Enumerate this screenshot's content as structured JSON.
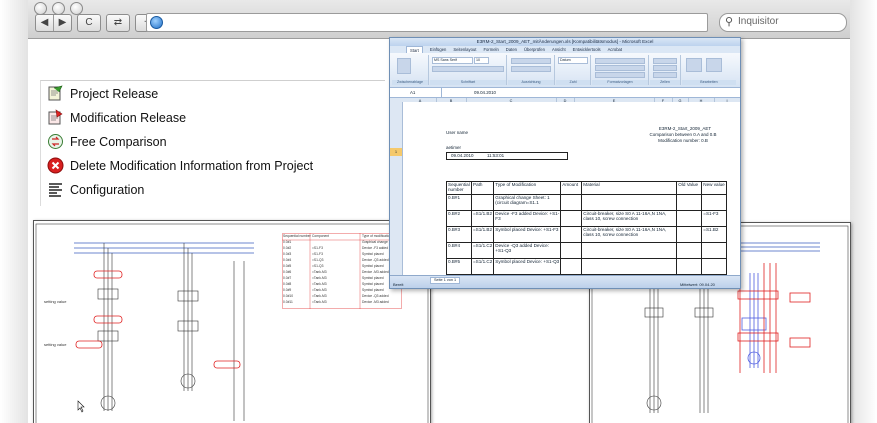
{
  "browser": {
    "search_placeholder": "Inquisitor",
    "nav_labels": [
      "◀",
      "▶",
      "C",
      "⇄",
      "+"
    ]
  },
  "menu": {
    "items": [
      {
        "label": "Project Release",
        "icon": "project-release-icon"
      },
      {
        "label": "Modification Release",
        "icon": "modification-release-icon"
      },
      {
        "label": "Free Comparison",
        "icon": "free-comparison-icon"
      },
      {
        "label": "Delete Modification Information from Project",
        "icon": "delete-modification-icon"
      },
      {
        "label": "Configuration",
        "icon": "configuration-icon"
      }
    ]
  },
  "excel": {
    "title": "E3RM-2_Start_2009_AET_mitÄnderungen.xls [Kompatibilitätsmodus] - Microsoft Excel",
    "tabs": [
      "Start",
      "Einfügen",
      "Seitenlayout",
      "Formeln",
      "Daten",
      "Überprüfen",
      "Ansicht",
      "Entwicklertools",
      "Acrobat"
    ],
    "groups": [
      "Zwischenablage",
      "Schriftart",
      "Ausrichtung",
      "Zahl",
      "Formatvorlagen",
      "Zellen",
      "Bearbeiten"
    ],
    "font_name": "MS Sans Serif",
    "font_size": "10",
    "number_format": "Datum",
    "cell_ref": "A1",
    "formula_value": "09.04.2010",
    "col_headers": [
      "A",
      "B",
      "C",
      "D",
      "E",
      "F",
      "G",
      "H",
      "I"
    ],
    "doc": {
      "right_title": "E3RM-2_Start_2009_AET",
      "right_line2": "Comparison between 0.A and 0.B",
      "right_line3": "Modification number: 0.B",
      "user_label": "User name",
      "user_value": "aetimer",
      "date": "09.04.2010",
      "time": "11:53:01",
      "row_num": "1",
      "headers": [
        "Sequential number",
        "Path",
        "Type of Modification",
        "Amount",
        "Material",
        "Old Value",
        "New value"
      ],
      "rows": [
        {
          "seq": "0.B#1",
          "path": "",
          "type": "Graphical change Sheet: 1 (circuit diagram=S1.1",
          "material": "",
          "new": ""
        },
        {
          "seq": "0.B#2",
          "path": "=S1/1.B2",
          "type": "Device -F3 added Device: +S1-F3",
          "material": "Circuit-breaker, size S0 A 11-16A,N 1NA, class 10, screw connection",
          "new": "=S1-F3"
        },
        {
          "seq": "0.B#3",
          "path": "=S1/1.B2",
          "type": "Symbol placed Device: +S1-F3",
          "material": "Circuit-breaker, size S0 A 11-16A,N 1NA, class 10, screw connection",
          "new": "=S1.B2"
        },
        {
          "seq": "0.B#4",
          "path": "=S1/1.C2",
          "type": "Device -Q3 added Device: +S1-Q3",
          "material": "",
          "new": ""
        },
        {
          "seq": "0.B#5",
          "path": "=S1/1.C2",
          "type": "Symbol placed Device: +S1-Q3",
          "material": "",
          "new": ""
        },
        {
          "seq": "0.B#6",
          "path": "=S1/1.E2",
          "type": "Device -M3 added Device: +Tank-M3",
          "material": "",
          "new": ""
        }
      ]
    },
    "sheet_tab": "Seite 1 von 1",
    "status_ready": "Bereit",
    "status_right": "Mittelwert: 09.04.20"
  },
  "schematic_left": {
    "table_headers": [
      "Sequential number",
      "Component",
      "Type of modification"
    ],
    "table_rows": [
      [
        "0.0#1",
        "",
        "Graphical change"
      ],
      [
        "0.0#2",
        "=S1-F3",
        "Device -F3 added"
      ],
      [
        "0.0#3",
        "=S1-F3",
        "Symbol placed"
      ],
      [
        "0.0#4",
        "=S1-Q3",
        "Device -Q3 added"
      ],
      [
        "0.0#5",
        "=S1-Q3",
        "Symbol placed"
      ],
      [
        "0.0#6",
        "=Tank-M3",
        "Device -M3 added"
      ],
      [
        "0.0#7",
        "=Tank-M3",
        "Symbol placed"
      ],
      [
        "0.0#8",
        "=Tank-M3",
        "Symbol placed"
      ],
      [
        "0.0#9",
        "=Tank-M3",
        "Symbol placed"
      ],
      [
        "0.0#10",
        "=Tank-M3",
        "Device -Q3 added"
      ],
      [
        "0.0#11",
        "=Tank-M3",
        "Device -M3 added"
      ]
    ]
  },
  "colors": {
    "accent_red": "#e02020",
    "highlight_blue": "#4f5de0",
    "excel_frame": "#6f8fb5"
  }
}
